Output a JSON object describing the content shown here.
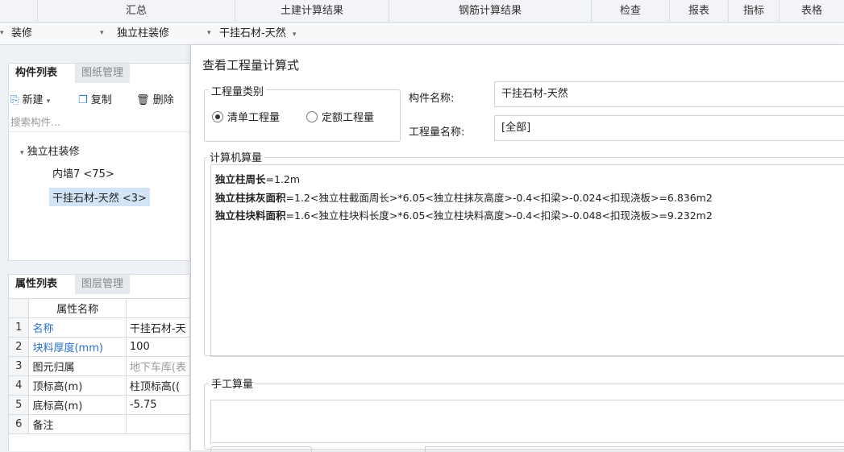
{
  "top_tabs": [
    "汇总",
    "土建计算结果",
    "钢筋计算结果",
    "检查",
    "报表",
    "指标",
    "表格"
  ],
  "selectors": [
    {
      "label": "装修",
      "caret": "▾"
    },
    {
      "label": "独立柱装修",
      "caret": "▾"
    },
    {
      "label": "干挂石材-天然",
      "caret": "▾"
    }
  ],
  "left_panel": {
    "component_tabs": [
      "构件列表",
      "图纸管理"
    ],
    "toolbar": {
      "new": "新建",
      "new_caret": "▾",
      "copy": "复制",
      "delete": "删除"
    },
    "search_placeholder": "搜索构件...",
    "tree": {
      "group": "独立柱装修",
      "items": [
        "内墙7 <75>",
        "干挂石材-天然 <3>"
      ]
    },
    "prop_tabs": [
      "属性列表",
      "图层管理"
    ],
    "prop_header": "属性名称",
    "props": [
      {
        "n": "1",
        "name": "名称",
        "value": "干挂石材-天"
      },
      {
        "n": "2",
        "name": "块料厚度(mm)",
        "value": "100"
      },
      {
        "n": "3",
        "name": "图元归属",
        "value": "地下车库(表"
      },
      {
        "n": "4",
        "name": "顶标高(m)",
        "value": "柱顶标高(("
      },
      {
        "n": "5",
        "name": "底标高(m)",
        "value": "-5.75"
      },
      {
        "n": "6",
        "name": "备注",
        "value": ""
      }
    ]
  },
  "dialog": {
    "title": "查看工程量计算式",
    "quantity_type_label": "工程量类别",
    "radio_list": "清单工程量",
    "radio_quota": "定额工程量",
    "component_name_label": "构件名称:",
    "component_name_value": "干挂石材-天然",
    "quantity_name_label": "工程量名称:",
    "quantity_name_value": "[全部]",
    "computer_calc_label": "计算机算量",
    "formulas": [
      {
        "name": "独立柱周长",
        "expr": "=1.2m"
      },
      {
        "name": "独立柱抹灰面积",
        "expr": "=1.2<独立柱截面周长>*6.05<独立柱抹灰高度>-0.4<扣梁>-0.024<扣现浇板>=6.836m2"
      },
      {
        "name": "独立柱块料面积",
        "expr": "=1.6<独立柱块料长度>*6.05<独立柱块料高度>-0.4<扣梁>-0.048<扣现浇板>=9.232m2"
      }
    ],
    "manual_calc_label": "手工算量"
  }
}
